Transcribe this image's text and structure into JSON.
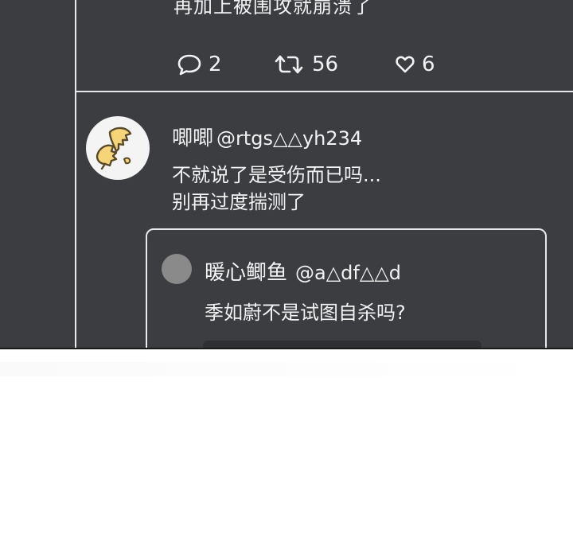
{
  "prev_tweet": {
    "text": "再加上被围攻就崩溃了",
    "reply_count": "2",
    "retweet_count": "56",
    "like_count": "6",
    "icons": {
      "reply": "reply-icon",
      "retweet": "retweet-icon",
      "like": "heart-icon"
    }
  },
  "reply_tweet": {
    "display_name": "唧唧",
    "handle": "@rtgs△△yh234",
    "line1": "不就说了是受伤而已吗...",
    "line2": "别再过度揣测了",
    "avatar_icon": "ginkgo-leaf-icon"
  },
  "quoted_tweet": {
    "display_name": "暖心鲫鱼",
    "handle": "@a△df△△d",
    "text": "季如蔚不是试图自杀吗?"
  },
  "colors": {
    "panel_bg": "#3b3d41",
    "text": "#f2f2f2",
    "divider": "#e8e8e8",
    "page_bg": "#ffffff",
    "leaf_fill": "#f6d57a",
    "leaf_stroke": "#5a4a2a"
  }
}
